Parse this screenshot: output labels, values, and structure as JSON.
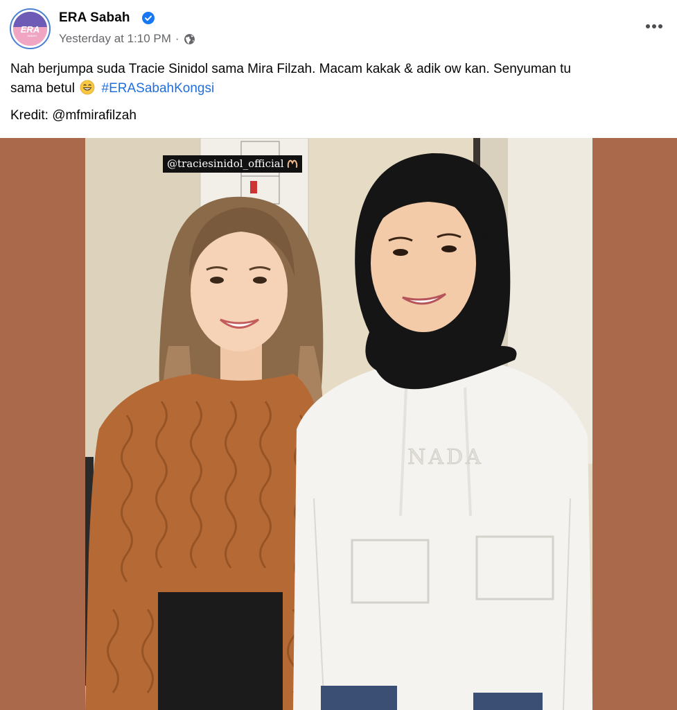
{
  "post": {
    "page_name": "ERA Sabah",
    "avatar_logo_text": "ERA",
    "avatar_sub_text": "SABAH",
    "timestamp": "Yesterday at 1:10 PM",
    "separator": "·",
    "audience_icon": "globe-icon",
    "verified_icon": "verified-badge-icon",
    "more_icon": "more-options-icon",
    "text_line_1": "Nah berjumpa suda Tracie Sinidol sama Mira Filzah. Macam kakak & adik ow kan. Senyuman tu",
    "text_line_2_prefix": "sama betul",
    "emoji": "grinning-face-icon",
    "hashtag": "#ERASabahKongsi",
    "credit": "Kredit: @mfmirafilzah"
  },
  "photo": {
    "instagram_tag": "@traciesinidol_official",
    "hoodie_text": "NADA",
    "frame_color": "#a9694a"
  },
  "colors": {
    "link": "#216fdb",
    "secondary_text": "#65676b",
    "verified": "#1877f2"
  }
}
